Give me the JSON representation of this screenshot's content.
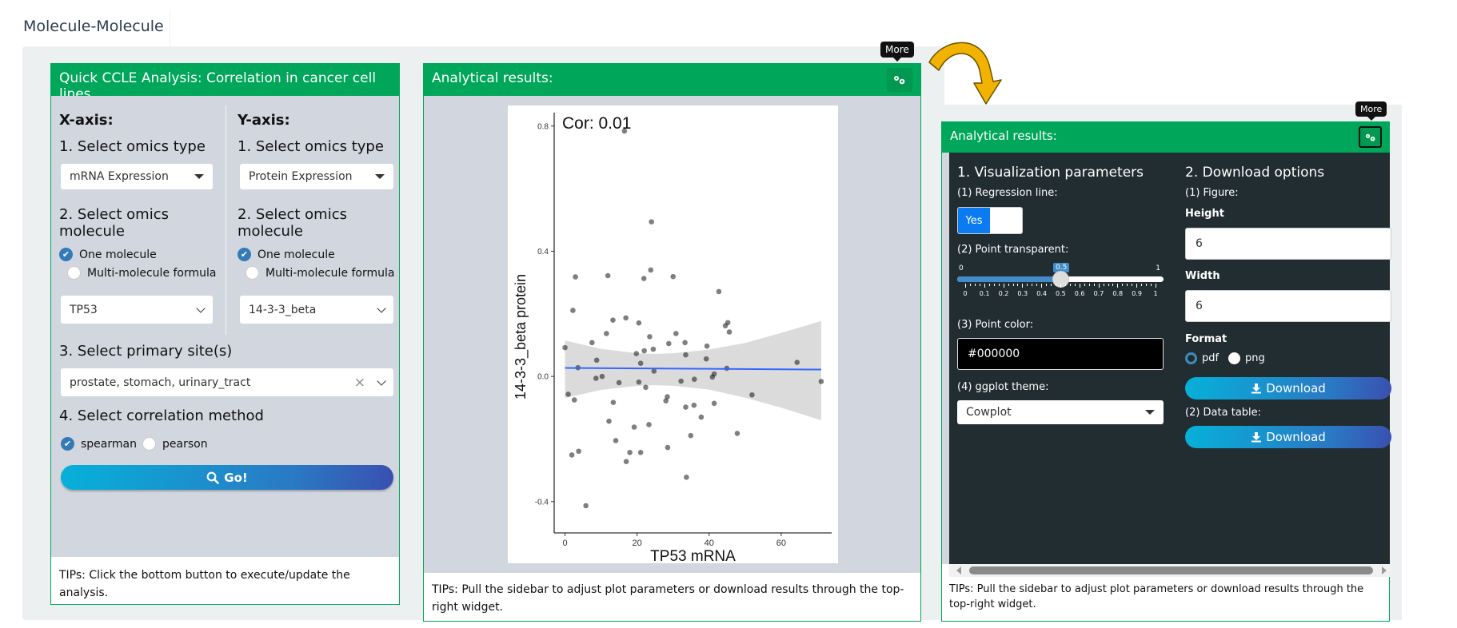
{
  "tab": {
    "label": "Molecule-Molecule"
  },
  "left_panel": {
    "title": "Quick CCLE Analysis: Correlation in cancer cell lines",
    "x_axis": {
      "heading": "X-axis:",
      "omics_type_label": "1. Select omics type",
      "omics_type_value": "mRNA Expression",
      "molecule_label_line1": "2. Select omics",
      "molecule_label_line2": "molecule",
      "option_one": "One molecule",
      "option_multi": "Multi-molecule formula",
      "molecule_value": "TP53"
    },
    "y_axis": {
      "heading": "Y-axis:",
      "omics_type_label": "1. Select omics type",
      "omics_type_value": "Protein Expression",
      "molecule_label_line1": "2. Select omics",
      "molecule_label_line2": "molecule",
      "option_one": "One molecule",
      "option_multi": "Multi-molecule formula",
      "molecule_value": "14-3-3_beta"
    },
    "primary_site_label": "3. Select primary site(s)",
    "primary_site_value": "prostate, stomach, urinary_tract",
    "clear_symbol": "×",
    "method_label": "4. Select correlation method",
    "method_options": [
      "spearman",
      "pearson"
    ],
    "method_selected": "spearman",
    "go_button": "Go!",
    "tips": "TIPs: Click the bottom button to execute/update the analysis."
  },
  "middle_panel": {
    "title": "Analytical results:",
    "tooltip": "More",
    "tips": "TIPs: Pull the sidebar to adjust plot parameters or download results through the top-right widget."
  },
  "right_panel": {
    "title": "Analytical results:",
    "tooltip": "More",
    "viz": {
      "heading": "1. Visualization parameters",
      "regression_label": "(1) Regression line:",
      "regression_value": "Yes",
      "transparent_label": "(2) Point transparent:",
      "transparent_min": "0",
      "transparent_max": "1",
      "transparent_value": 0.5,
      "transparent_value_label": "0.5",
      "transparent_ticks": [
        "0",
        "0.1",
        "0.2",
        "0.3",
        "0.4",
        "0.5",
        "0.6",
        "0.7",
        "0.8",
        "0.9",
        "1"
      ],
      "color_label": "(3) Point color:",
      "color_value": "#000000",
      "theme_label": "(4) ggplot theme:",
      "theme_value": "Cowplot"
    },
    "download": {
      "heading": "2. Download options",
      "figure_label": "(1) Figure:",
      "height_label": "Height",
      "height_value": "6",
      "width_label": "Width",
      "width_value": "6",
      "format_label": "Format",
      "format_options": [
        "pdf",
        "png"
      ],
      "format_selected": "pdf",
      "download_button": "Download",
      "data_table_label": "(2) Data table:",
      "download_table_button": "Download"
    },
    "tips": "TIPs: Pull the sidebar to adjust plot parameters or download results through the top-right widget."
  },
  "colors": {
    "header_green": "#00a65a",
    "dark_sidebar": "#222d32",
    "regression_line": "#3366ff",
    "point": "#555555",
    "arrow": "#f2b200"
  },
  "chart_data": {
    "type": "scatter",
    "title": "Cor: 0.01",
    "xlabel": "TP53 mRNA",
    "ylabel": "14-3-3_beta protein",
    "xlim": [
      -3,
      74
    ],
    "ylim": [
      -0.5,
      0.83
    ],
    "x_ticks": [
      0,
      20,
      40,
      60
    ],
    "x_tick_labels": [
      "0",
      "20",
      "40",
      "60"
    ],
    "y_ticks": [
      -0.4,
      0.0,
      0.4,
      0.8
    ],
    "y_tick_labels": [
      "-0.4",
      "0.0",
      "0.4",
      "0.8"
    ],
    "grid": false,
    "points": [
      [
        16.5,
        0.784
      ],
      [
        24.0,
        0.494
      ],
      [
        2.9,
        0.318
      ],
      [
        11.9,
        0.322
      ],
      [
        21.9,
        0.313
      ],
      [
        23.8,
        0.34
      ],
      [
        30.0,
        0.319
      ],
      [
        42.7,
        0.271
      ],
      [
        2.2,
        0.211
      ],
      [
        13.3,
        0.18
      ],
      [
        16.9,
        0.187
      ],
      [
        20.5,
        0.171
      ],
      [
        11.5,
        0.137
      ],
      [
        44.5,
        0.162
      ],
      [
        45.2,
        0.172
      ],
      [
        45.6,
        0.142
      ],
      [
        0.0,
        0.092
      ],
      [
        0.9,
        -0.057
      ],
      [
        2.6,
        -0.075
      ],
      [
        1.9,
        -0.251
      ],
      [
        3.8,
        -0.239
      ],
      [
        3.6,
        0.028
      ],
      [
        5.8,
        -0.413
      ],
      [
        7.5,
        0.108
      ],
      [
        8.8,
        0.052
      ],
      [
        8.6,
        -0.006
      ],
      [
        10.3,
        0.0
      ],
      [
        13.4,
        -0.083
      ],
      [
        12.2,
        -0.143
      ],
      [
        14.1,
        -0.205
      ],
      [
        15.0,
        -0.02
      ],
      [
        17.0,
        -0.272
      ],
      [
        18.0,
        -0.243
      ],
      [
        19.2,
        -0.162
      ],
      [
        19.8,
        0.073
      ],
      [
        20.5,
        -0.018
      ],
      [
        21.0,
        -0.243
      ],
      [
        21.0,
        0.042
      ],
      [
        22.0,
        0.082
      ],
      [
        22.4,
        -0.035
      ],
      [
        23.3,
        -0.154
      ],
      [
        23.5,
        0.127
      ],
      [
        24.5,
        0.087
      ],
      [
        24.7,
        0.017
      ],
      [
        28.0,
        -0.078
      ],
      [
        28.4,
        -0.065
      ],
      [
        28.5,
        -0.227
      ],
      [
        28.8,
        0.105
      ],
      [
        30.8,
        0.137
      ],
      [
        32.2,
        -0.015
      ],
      [
        33.3,
        0.108
      ],
      [
        33.5,
        0.069
      ],
      [
        33.5,
        -0.098
      ],
      [
        33.7,
        -0.322
      ],
      [
        34.9,
        -0.189
      ],
      [
        35.8,
        -0.092
      ],
      [
        35.9,
        -0.009
      ],
      [
        37.8,
        -0.13
      ],
      [
        39.2,
        0.056
      ],
      [
        39.4,
        0.097
      ],
      [
        40.9,
        -0.002
      ],
      [
        41.4,
        0.008
      ],
      [
        41.4,
        -0.086
      ],
      [
        44.9,
        0.026
      ],
      [
        47.8,
        -0.182
      ],
      [
        51.9,
        -0.059
      ],
      [
        64.4,
        0.045
      ],
      [
        71.1,
        -0.016
      ]
    ],
    "regression_line": {
      "x": [
        0,
        71.1
      ],
      "y": [
        0.027,
        0.022
      ]
    },
    "confidence_band": {
      "x": [
        0,
        10,
        20,
        25,
        30,
        40,
        50,
        60,
        71.1
      ],
      "upper": [
        0.115,
        0.088,
        0.074,
        0.072,
        0.074,
        0.086,
        0.107,
        0.139,
        0.177
      ],
      "lower": [
        -0.069,
        -0.043,
        -0.03,
        -0.028,
        -0.03,
        -0.042,
        -0.068,
        -0.1,
        -0.14
      ]
    }
  }
}
